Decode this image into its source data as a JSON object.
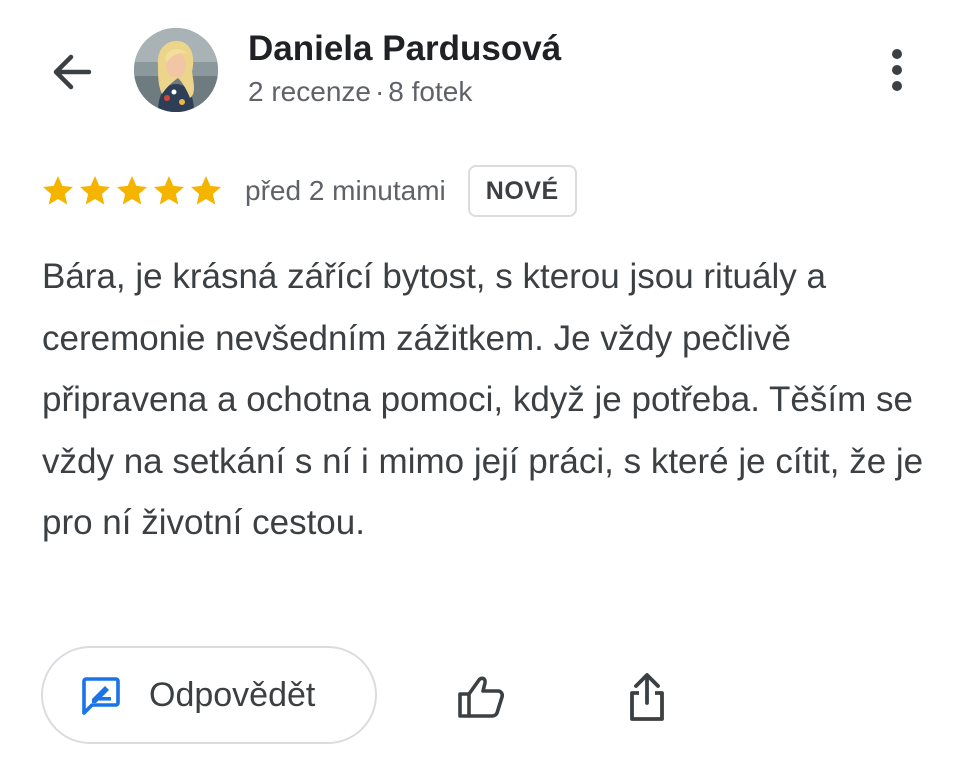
{
  "colors": {
    "star": "#f4b400",
    "icon": "#3c4043",
    "reply_icon": "#1a73e8",
    "text_primary": "#202124",
    "text_secondary": "#5f6368",
    "border": "#dadce0"
  },
  "header": {
    "back_icon": "arrow-left-icon",
    "avatar_icon": "user-photo",
    "user_name": "Daniela Pardusová",
    "reviews_count": "2 recenze",
    "separator": "·",
    "photos_count": "8 fotek",
    "more_icon": "more-vertical-icon"
  },
  "review": {
    "rating": 5,
    "rating_max": 5,
    "time_ago": "před 2 minutami",
    "badge": "NOVÉ",
    "text": "Bára, je krásná zářící bytost, s kterou jsou rituály a ceremonie nevšedním zážitkem. Je vždy pečlivě připravena a ochotna pomoci, když je potřeba. Těším se vždy na setkání s ní i mimo její práci, s které je cítit, že je pro ní životní cestou."
  },
  "actions": {
    "reply_icon": "rate-review-icon",
    "reply_label": "Odpovědět",
    "like_icon": "thumb-up-icon",
    "share_icon": "share-icon"
  }
}
